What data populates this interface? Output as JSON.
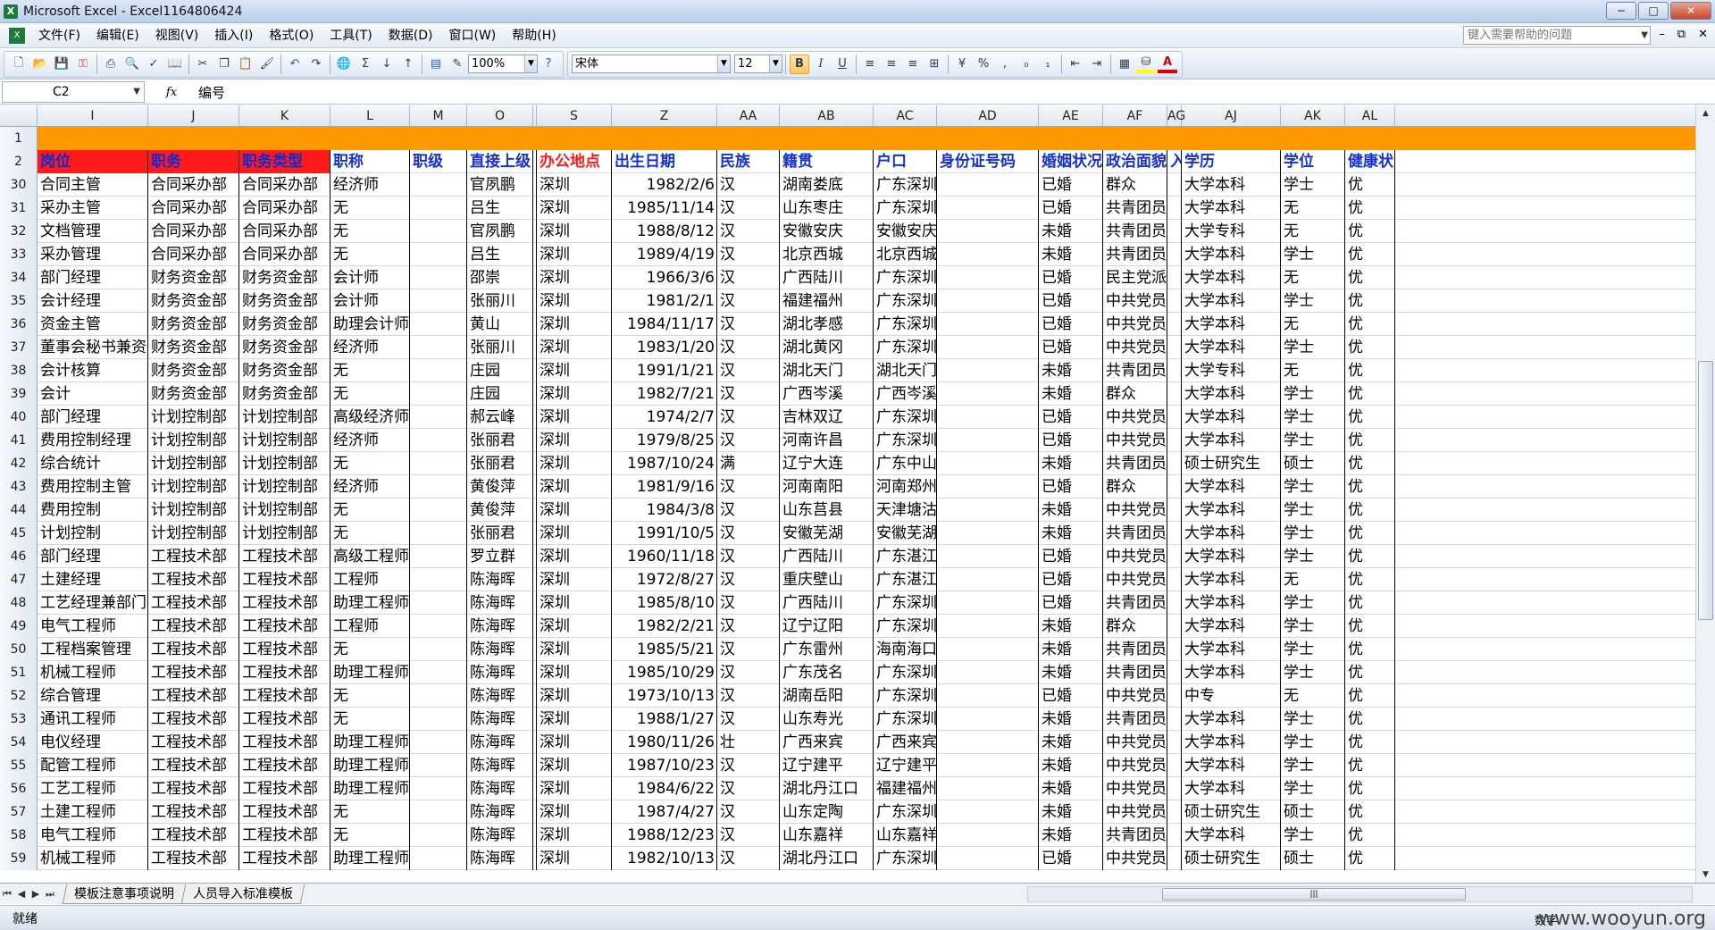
{
  "window": {
    "title": "Microsoft Excel - Excel1164806424",
    "app_icon": "excel-icon",
    "buttons": [
      "minimize",
      "maximize",
      "close"
    ]
  },
  "menubar": {
    "items": [
      "文件(F)",
      "编辑(E)",
      "视图(V)",
      "插入(I)",
      "格式(O)",
      "工具(T)",
      "数据(D)",
      "窗口(W)",
      "帮助(H)"
    ],
    "help_placeholder": "键入需要帮助的问题"
  },
  "toolbar": {
    "zoom": "100%",
    "font_name": "宋体",
    "font_size": "12",
    "icons": [
      "new-icon",
      "open-icon",
      "save-icon",
      "permission-icon",
      "print-icon",
      "print-preview-icon",
      "spelling-icon",
      "research-icon",
      "cut-icon",
      "copy-icon",
      "paste-icon",
      "format-painter-icon",
      "undo-icon",
      "redo-icon",
      "hyperlink-icon",
      "autosum-icon",
      "sort-ascending-icon",
      "sort-descending-icon",
      "chart-wizard-icon",
      "drawing-icon",
      "help-icon"
    ],
    "format_icons": [
      "bold-icon",
      "italic-icon",
      "underline-icon",
      "align-left-icon",
      "align-center-icon",
      "align-right-icon",
      "merge-center-icon",
      "currency-icon",
      "percent-icon",
      "comma-icon",
      "increase-decimal-icon",
      "decrease-decimal-icon",
      "decrease-indent-icon",
      "increase-indent-icon",
      "borders-icon",
      "fill-color-icon",
      "font-color-icon"
    ],
    "font_color": "#e00000",
    "fill_color": "#ffff00"
  },
  "formula_bar": {
    "name_box": "C2",
    "fx": "fx",
    "content": "编号"
  },
  "columns": [
    "I",
    "J",
    "K",
    "L",
    "M",
    "O",
    "",
    "S",
    "Z",
    "AA",
    "AB",
    "AC",
    "AD",
    "AE",
    "AF",
    "AG",
    "AJ",
    "AK",
    "AL"
  ],
  "header_row": {
    "row_num": "2",
    "cells": [
      "岗位",
      "职务",
      "职务类型",
      "职称",
      "职级",
      "直接上级",
      "",
      "办公地点",
      "出生日期",
      "民族",
      "籍贯",
      "户口",
      "身份证号码",
      "婚姻状况",
      "政治面貌",
      "入",
      "学历",
      "学位",
      "健康状"
    ]
  },
  "row1_num": "1",
  "data_rows": [
    [
      "30",
      "合同主管",
      "合同采办部",
      "合同采办部",
      "经济师",
      "",
      "官夙鹏",
      "",
      "深圳",
      "1982/2/6",
      "汉",
      "湖南娄底",
      "广东深圳",
      "",
      "已婚",
      "群众",
      "",
      "大学本科",
      "学士",
      "优"
    ],
    [
      "31",
      "采办主管",
      "合同采办部",
      "合同采办部",
      "无",
      "",
      "吕生",
      "",
      "深圳",
      "1985/11/14",
      "汉",
      "山东枣庄",
      "广东深圳",
      "",
      "已婚",
      "共青团员",
      "",
      "大学本科",
      "无",
      "优"
    ],
    [
      "32",
      "文档管理",
      "合同采办部",
      "合同采办部",
      "无",
      "",
      "官夙鹏",
      "",
      "深圳",
      "1988/8/12",
      "汉",
      "安徽安庆",
      "安徽安庆",
      "",
      "未婚",
      "共青团员",
      "",
      "大学专科",
      "无",
      "优"
    ],
    [
      "33",
      "采办管理",
      "合同采办部",
      "合同采办部",
      "无",
      "",
      "吕生",
      "",
      "深圳",
      "1989/4/19",
      "汉",
      "北京西城",
      "北京西城",
      "",
      "未婚",
      "共青团员",
      "",
      "大学本科",
      "学士",
      "优"
    ],
    [
      "34",
      "部门经理",
      "财务资金部",
      "财务资金部",
      "会计师",
      "",
      "邵崇",
      "",
      "深圳",
      "1966/3/6",
      "汉",
      "广西陆川",
      "广东深圳",
      "",
      "已婚",
      "民主党派",
      "",
      "大学本科",
      "无",
      "优"
    ],
    [
      "35",
      "会计经理",
      "财务资金部",
      "财务资金部",
      "会计师",
      "",
      "张丽川",
      "",
      "深圳",
      "1981/2/1",
      "汉",
      "福建福州",
      "广东深圳",
      "",
      "已婚",
      "中共党员",
      "",
      "大学本科",
      "学士",
      "优"
    ],
    [
      "36",
      "资金主管",
      "财务资金部",
      "财务资金部",
      "助理会计师",
      "",
      "黄山",
      "",
      "深圳",
      "1984/11/17",
      "汉",
      "湖北孝感",
      "广东深圳",
      "",
      "已婚",
      "中共党员",
      "",
      "大学本科",
      "无",
      "优"
    ],
    [
      "37",
      "董事会秘书兼资金",
      "财务资金部",
      "财务资金部",
      "经济师",
      "",
      "张丽川",
      "",
      "深圳",
      "1983/1/20",
      "汉",
      "湖北黄冈",
      "广东深圳",
      "",
      "已婚",
      "中共党员",
      "",
      "大学本科",
      "学士",
      "优"
    ],
    [
      "38",
      "会计核算",
      "财务资金部",
      "财务资金部",
      "无",
      "",
      "庄园",
      "",
      "深圳",
      "1991/1/21",
      "汉",
      "湖北天门",
      "湖北天门",
      "",
      "未婚",
      "共青团员",
      "",
      "大学专科",
      "无",
      "优"
    ],
    [
      "39",
      "会计",
      "财务资金部",
      "财务资金部",
      "无",
      "",
      "庄园",
      "",
      "深圳",
      "1982/7/21",
      "汉",
      "广西岑溪",
      "广西岑溪",
      "",
      "未婚",
      "群众",
      "",
      "大学本科",
      "学士",
      "优"
    ],
    [
      "40",
      "部门经理",
      "计划控制部",
      "计划控制部",
      "高级经济师",
      "",
      "郝云峰",
      "",
      "深圳",
      "1974/2/7",
      "汉",
      "吉林双辽",
      "广东深圳",
      "",
      "已婚",
      "中共党员",
      "",
      "大学本科",
      "学士",
      "优"
    ],
    [
      "41",
      "费用控制经理",
      "计划控制部",
      "计划控制部",
      "经济师",
      "",
      "张丽君",
      "",
      "深圳",
      "1979/8/25",
      "汉",
      "河南许昌",
      "广东深圳",
      "",
      "已婚",
      "中共党员",
      "",
      "大学本科",
      "学士",
      "优"
    ],
    [
      "42",
      "综合统计",
      "计划控制部",
      "计划控制部",
      "无",
      "",
      "张丽君",
      "",
      "深圳",
      "1987/10/24",
      "满",
      "辽宁大连",
      "广东中山",
      "",
      "未婚",
      "共青团员",
      "",
      "硕士研究生",
      "硕士",
      "优"
    ],
    [
      "43",
      "费用控制主管",
      "计划控制部",
      "计划控制部",
      "经济师",
      "",
      "黄俊萍",
      "",
      "深圳",
      "1981/9/16",
      "汉",
      "河南南阳",
      "河南郑州",
      "",
      "已婚",
      "群众",
      "",
      "大学本科",
      "学士",
      "优"
    ],
    [
      "44",
      "费用控制",
      "计划控制部",
      "计划控制部",
      "无",
      "",
      "黄俊萍",
      "",
      "深圳",
      "1984/3/8",
      "汉",
      "山东莒县",
      "天津塘沽",
      "",
      "未婚",
      "中共党员",
      "",
      "大学本科",
      "学士",
      "优"
    ],
    [
      "45",
      "计划控制",
      "计划控制部",
      "计划控制部",
      "无",
      "",
      "张丽君",
      "",
      "深圳",
      "1991/10/5",
      "汉",
      "安徽芜湖",
      "安徽芜湖",
      "",
      "未婚",
      "共青团员",
      "",
      "大学本科",
      "学士",
      "优"
    ],
    [
      "46",
      "部门经理",
      "工程技术部",
      "工程技术部",
      "高级工程师",
      "",
      "罗立群",
      "",
      "深圳",
      "1960/11/18",
      "汉",
      "广西陆川",
      "广东湛江",
      "",
      "已婚",
      "中共党员",
      "",
      "大学本科",
      "学士",
      "优"
    ],
    [
      "47",
      "土建经理",
      "工程技术部",
      "工程技术部",
      "工程师",
      "",
      "陈海晖",
      "",
      "深圳",
      "1972/8/27",
      "汉",
      "重庆壁山",
      "广东湛江",
      "",
      "已婚",
      "中共党员",
      "",
      "大学本科",
      "无",
      "优"
    ],
    [
      "48",
      "工艺经理兼部门经",
      "工程技术部",
      "工程技术部",
      "助理工程师",
      "",
      "陈海晖",
      "",
      "深圳",
      "1985/8/10",
      "汉",
      "广西陆川",
      "广东深圳",
      "",
      "已婚",
      "共青团员",
      "",
      "大学本科",
      "学士",
      "优"
    ],
    [
      "49",
      "电气工程师",
      "工程技术部",
      "工程技术部",
      "工程师",
      "",
      "陈海晖",
      "",
      "深圳",
      "1982/2/21",
      "汉",
      "辽宁辽阳",
      "广东深圳",
      "",
      "未婚",
      "群众",
      "",
      "大学本科",
      "学士",
      "优"
    ],
    [
      "50",
      "工程档案管理",
      "工程技术部",
      "工程技术部",
      "无",
      "",
      "陈海晖",
      "",
      "深圳",
      "1985/5/21",
      "汉",
      "广东雷州",
      "海南海口",
      "",
      "未婚",
      "共青团员",
      "",
      "大学本科",
      "学士",
      "优"
    ],
    [
      "51",
      "机械工程师",
      "工程技术部",
      "工程技术部",
      "助理工程师",
      "",
      "陈海晖",
      "",
      "深圳",
      "1985/10/29",
      "汉",
      "广东茂名",
      "广东深圳",
      "",
      "未婚",
      "共青团员",
      "",
      "大学本科",
      "学士",
      "优"
    ],
    [
      "52",
      "综合管理",
      "工程技术部",
      "工程技术部",
      "无",
      "",
      "陈海晖",
      "",
      "深圳",
      "1973/10/13",
      "汉",
      "湖南岳阳",
      "广东深圳",
      "",
      "已婚",
      "中共党员",
      "",
      "中专",
      "无",
      "优"
    ],
    [
      "53",
      "通讯工程师",
      "工程技术部",
      "工程技术部",
      "无",
      "",
      "陈海晖",
      "",
      "深圳",
      "1988/1/27",
      "汉",
      "山东寿光",
      "广东深圳",
      "",
      "未婚",
      "共青团员",
      "",
      "大学本科",
      "学士",
      "优"
    ],
    [
      "54",
      "电仪经理",
      "工程技术部",
      "工程技术部",
      "助理工程师",
      "",
      "陈海晖",
      "",
      "深圳",
      "1980/11/26",
      "壮",
      "广西来宾",
      "广西来宾",
      "",
      "未婚",
      "中共党员",
      "",
      "大学本科",
      "学士",
      "优"
    ],
    [
      "55",
      "配管工程师",
      "工程技术部",
      "工程技术部",
      "助理工程师",
      "",
      "陈海晖",
      "",
      "深圳",
      "1987/10/23",
      "汉",
      "辽宁建平",
      "辽宁建平",
      "",
      "未婚",
      "中共党员",
      "",
      "大学本科",
      "学士",
      "优"
    ],
    [
      "56",
      "工艺工程师",
      "工程技术部",
      "工程技术部",
      "助理工程师",
      "",
      "陈海晖",
      "",
      "深圳",
      "1984/6/22",
      "汉",
      "湖北丹江口",
      "福建福州",
      "",
      "未婚",
      "中共党员",
      "",
      "大学本科",
      "学士",
      "优"
    ],
    [
      "57",
      "土建工程师",
      "工程技术部",
      "工程技术部",
      "无",
      "",
      "陈海晖",
      "",
      "深圳",
      "1987/4/27",
      "汉",
      "山东定陶",
      "广东深圳",
      "",
      "未婚",
      "中共党员",
      "",
      "硕士研究生",
      "硕士",
      "优"
    ],
    [
      "58",
      "电气工程师",
      "工程技术部",
      "工程技术部",
      "无",
      "",
      "陈海晖",
      "",
      "深圳",
      "1988/12/23",
      "汉",
      "山东嘉祥",
      "山东嘉祥",
      "",
      "未婚",
      "共青团员",
      "",
      "大学本科",
      "学士",
      "优"
    ],
    [
      "59",
      "机械工程师",
      "工程技术部",
      "工程技术部",
      "助理工程师",
      "",
      "陈海晖",
      "",
      "深圳",
      "1982/10/13",
      "汉",
      "湖北丹江口",
      "广东深圳",
      "",
      "已婚",
      "中共党员",
      "",
      "硕士研究生",
      "硕士",
      "优"
    ]
  ],
  "sheet_tabs": [
    "模板注意事项说明",
    "人员导入标准模板"
  ],
  "status": {
    "left": "就绪",
    "mode": "数字"
  },
  "watermark": "www.wooyun.org",
  "colors": {
    "header_orange": "#ff9900",
    "header_red_fill": "#ff1a1a",
    "header_blue_text": "#1531d4"
  }
}
